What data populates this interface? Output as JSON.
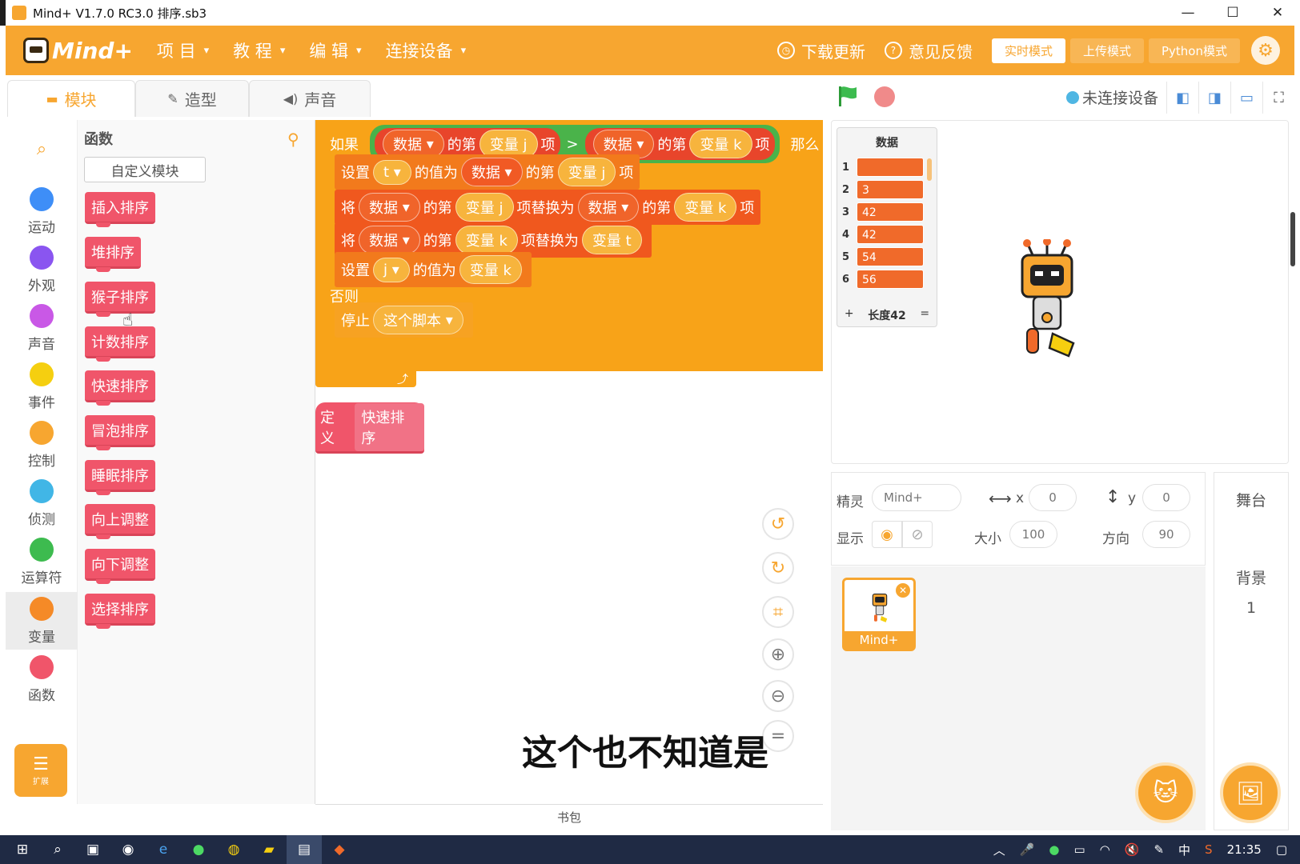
{
  "window": {
    "title": "Mind+ V1.7.0 RC3.0   排序.sb3",
    "minimize": "—",
    "maximize": "☐",
    "close": "✕"
  },
  "menubar": {
    "logo_text": "Mind+",
    "items": [
      {
        "label": "项 目",
        "caret": "▾"
      },
      {
        "label": "教 程",
        "caret": "▾"
      },
      {
        "label": "编 辑",
        "caret": "▾"
      },
      {
        "label": "连接设备",
        "caret": "▾"
      }
    ],
    "download_update": "下载更新",
    "feedback": "意见反馈",
    "mode_realtime": "实时模式",
    "mode_upload": "上传模式",
    "mode_python": "Python模式"
  },
  "tabs": [
    {
      "label": "模块",
      "icon": "blocks-icon"
    },
    {
      "label": "造型",
      "icon": "brush-icon"
    },
    {
      "label": "声音",
      "icon": "speaker-icon"
    }
  ],
  "connection_status": "未连接设备",
  "categories": [
    {
      "label": "运动",
      "color": "#3e8ef7"
    },
    {
      "label": "外观",
      "color": "#8a55f0"
    },
    {
      "label": "声音",
      "color": "#c958e6"
    },
    {
      "label": "事件",
      "color": "#f5cf10"
    },
    {
      "label": "控制",
      "color": "#f7a630"
    },
    {
      "label": "侦测",
      "color": "#41b6e6"
    },
    {
      "label": "运算符",
      "color": "#3dbb4f"
    },
    {
      "label": "变量",
      "color": "#f58a27"
    },
    {
      "label": "函数",
      "color": "#f0556a"
    }
  ],
  "extension_label": "扩展",
  "palette": {
    "title": "函数",
    "custom_block_button": "自定义模块",
    "blocks": [
      "插入排序",
      "堆排序",
      "猴子排序",
      "计数排序",
      "快速排序",
      "冒泡排序",
      "睡眠排序",
      "向上调整",
      "向下调整",
      "选择排序"
    ]
  },
  "script": {
    "if_label": "如果",
    "then_label": "那么",
    "else_label": "否则",
    "list_name": "数据",
    "of_label": "的第",
    "item_label": "项",
    "gt": ">",
    "var_j": "变量 j",
    "var_k": "变量 k",
    "var_t": "变量 t",
    "set_label": "设置",
    "to_label": "的值为",
    "replace_label": "将",
    "replace_with": "项替换为",
    "dd_t": "t",
    "dd_j": "j",
    "stop_label": "停止",
    "stop_option": "这个脚本",
    "define_label": "定义",
    "define_name": "快速排序"
  },
  "subtitle_caption": "这个也不知道是",
  "backpack_label": "书包",
  "stage": {
    "monitor": {
      "title": "数据",
      "rows": [
        {
          "index": "1",
          "value": ""
        },
        {
          "index": "2",
          "value": "3"
        },
        {
          "index": "3",
          "value": "42"
        },
        {
          "index": "4",
          "value": "42"
        },
        {
          "index": "5",
          "value": "54"
        },
        {
          "index": "6",
          "value": "56"
        }
      ],
      "add": "+",
      "length": "长度42",
      "resize": "="
    }
  },
  "sprite_info": {
    "sprite_label": "精灵",
    "sprite_name": "Mind+",
    "x_label": "x",
    "x_value": "0",
    "y_label": "y",
    "y_value": "0",
    "show_label": "显示",
    "size_label": "大小",
    "size_value": "100",
    "direction_label": "方向",
    "direction_value": "90"
  },
  "sprite_tile_name": "Mind+",
  "stage_panel": {
    "title": "舞台",
    "backdrop_label": "背景",
    "backdrop_count": "1"
  },
  "taskbar": {
    "time": "21:35",
    "ime": "中"
  }
}
